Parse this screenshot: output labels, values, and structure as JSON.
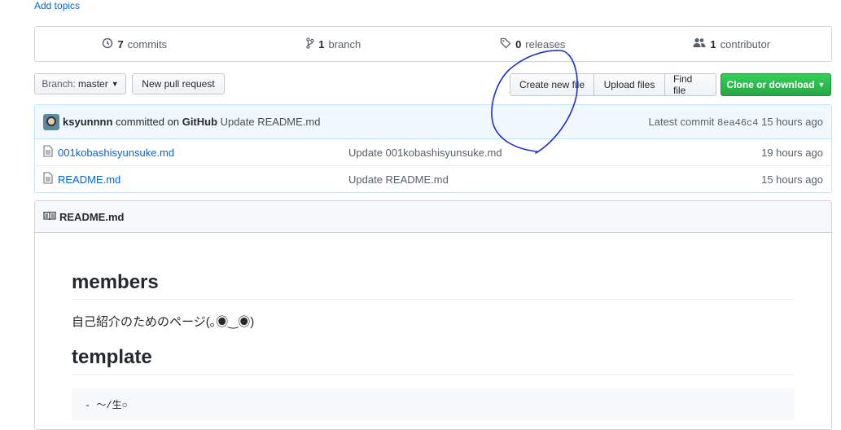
{
  "topics": {
    "add_label": "Add topics"
  },
  "summary": {
    "commits_count": "7",
    "commits_label": "commits",
    "branch_count": "1",
    "branch_label": "branch",
    "releases_count": "0",
    "releases_label": "releases",
    "contributor_count": "1",
    "contributor_label": "contributor"
  },
  "toolbar": {
    "branch_prefix": "Branch:",
    "branch_name": "master",
    "new_pr": "New pull request",
    "create_file": "Create new file",
    "upload_files": "Upload files",
    "find_file": "Find file",
    "clone": "Clone or download"
  },
  "commit": {
    "author": "ksyunnnn",
    "action": "committed on",
    "via": "GitHub",
    "message": "Update README.md",
    "latest_label": "Latest commit",
    "sha": "8ea46c4",
    "age": "15 hours ago"
  },
  "files": [
    {
      "name": "001kobashisyunsuke.md",
      "message": "Update 001kobashisyunsuke.md",
      "age": "19 hours ago"
    },
    {
      "name": "README.md",
      "message": "Update README.md",
      "age": "15 hours ago"
    }
  ],
  "readme": {
    "title": "README.md",
    "h_members": "members",
    "intro": "自己紹介のためのページ(｡◉‿◉)",
    "h_template": "template",
    "pre_snippet": "- ～/生○"
  },
  "colors": {
    "link": "#0366d6",
    "green": "#28a745",
    "scribble": "#1a2fd0"
  }
}
